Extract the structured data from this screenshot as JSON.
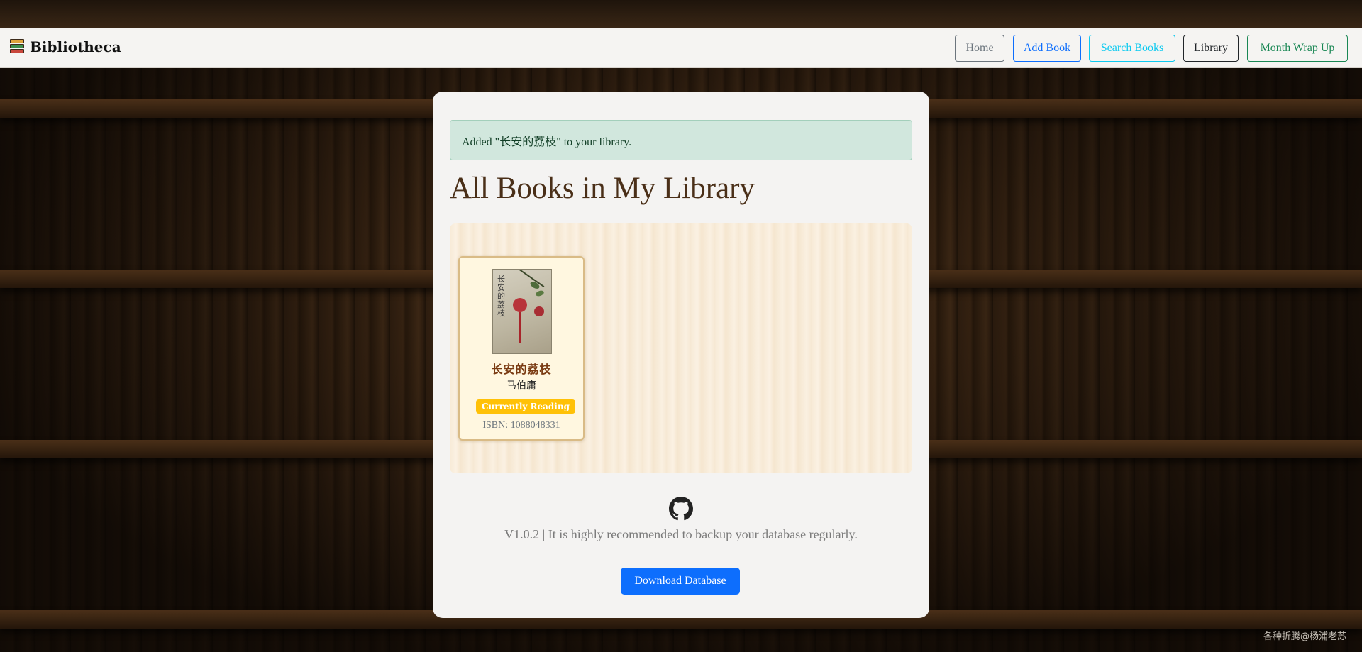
{
  "navbar": {
    "brand": "Bibliotheca",
    "links": {
      "home": "Home",
      "add_book": "Add Book",
      "search_books": "Search Books",
      "library": "Library",
      "month_wrap_up": "Month Wrap Up"
    }
  },
  "alert": {
    "message": "Added \"长安的荔枝\" to your library."
  },
  "page": {
    "title": "All Books in My Library"
  },
  "books": [
    {
      "title": "长安的荔枝",
      "author": "马伯庸",
      "status": "Currently Reading",
      "isbn": "ISBN: 1088048331",
      "cover_text": "长安的荔枝"
    }
  ],
  "footer": {
    "version_note": "V1.0.2 | It is highly recommended to backup your database regularly.",
    "download_label": "Download Database",
    "icon": "github-icon"
  },
  "watermark": "各种折腾@杨浦老苏",
  "colors": {
    "navbar_bg": "#f5f4f2",
    "alert_bg": "#d1e7dd",
    "title": "#4a2f18",
    "badge": "#ffc107",
    "primary": "#0d6efd"
  }
}
